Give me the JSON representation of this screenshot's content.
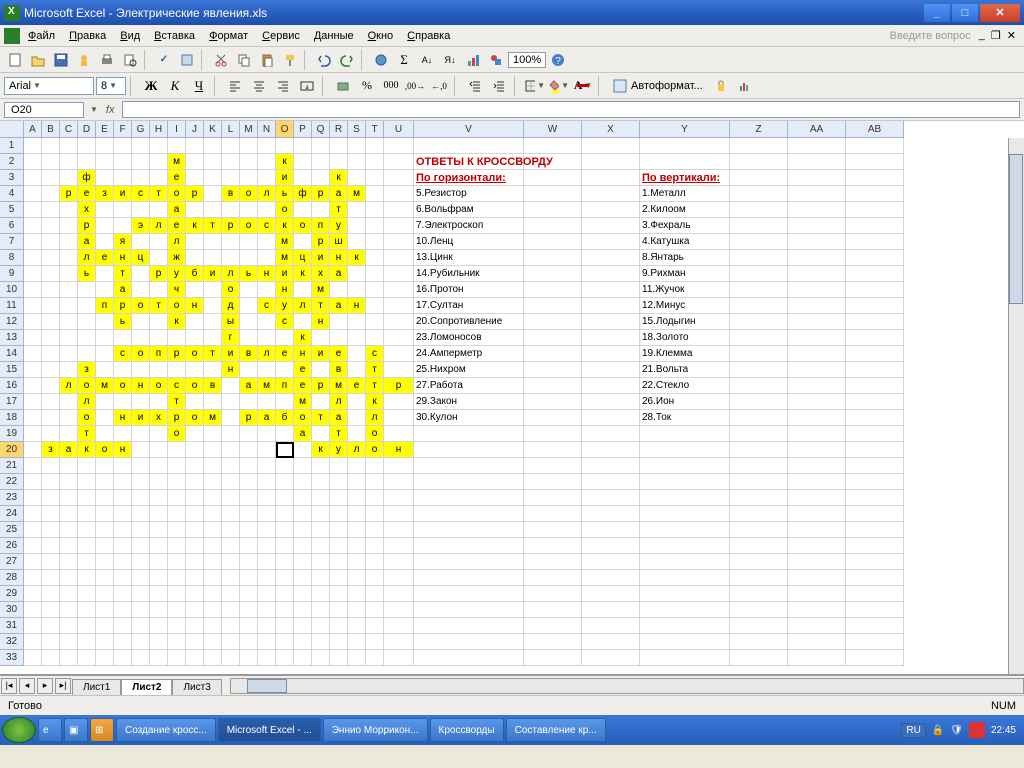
{
  "window": {
    "title": "Microsoft Excel - Электрические явления.xls"
  },
  "menu": [
    "Файл",
    "Правка",
    "Вид",
    "Вставка",
    "Формат",
    "Сервис",
    "Данные",
    "Окно",
    "Справка"
  ],
  "askbox": "Введите вопрос",
  "zoom": "100%",
  "font": {
    "name": "Arial",
    "size": "8"
  },
  "autoformat": "Автоформат...",
  "namebox": "O20",
  "columns": [
    "A",
    "B",
    "C",
    "D",
    "E",
    "F",
    "G",
    "H",
    "I",
    "J",
    "K",
    "L",
    "M",
    "N",
    "O",
    "P",
    "Q",
    "R",
    "S",
    "T",
    "U",
    "V",
    "W",
    "X",
    "Y",
    "Z",
    "AA",
    "AB"
  ],
  "narrow_count": 20,
  "row_count": 33,
  "selected": {
    "col": "O",
    "row": 20
  },
  "crossword": {
    "2": {
      "I": "м",
      "O": "к"
    },
    "3": {
      "D": "ф",
      "I": "е",
      "O": "и",
      "R": "к"
    },
    "4": {
      "C": "р",
      "D": "е",
      "E": "з",
      "F": "и",
      "G": "с",
      "H": "т",
      "I": "о",
      "J": "р",
      "L": "в",
      "M": "о",
      "N": "л",
      "O": "ь",
      "P": "ф",
      "Q": "р",
      "R": "а",
      "S": "м"
    },
    "5": {
      "D": "х",
      "I": "а",
      "O": "о",
      "R": "т"
    },
    "6": {
      "D": "р",
      "G": "э",
      "H": "л",
      "I": "е",
      "J": "к",
      "K": "т",
      "L": "р",
      "M": "о",
      "N": "с",
      "O": "к",
      "P": "о",
      "Q": "п",
      "R": "у"
    },
    "7": {
      "D": "а",
      "F": "я",
      "I": "л",
      "O": "м",
      "Q": "р",
      "R": "ш"
    },
    "8": {
      "D": "л",
      "E": "е",
      "F": "н",
      "G": "ц",
      "I": "ж",
      "O": "м",
      "P": "ц",
      "Q": "и",
      "R": "н",
      "S": "к"
    },
    "9": {
      "D": "ь",
      "F": "т",
      "H": "р",
      "I": "у",
      "J": "б",
      "K": "и",
      "L": "л",
      "M": "ь",
      "N": "н",
      "O": "и",
      "P": "к",
      "Q": "х",
      "R": "а"
    },
    "10": {
      "F": "а",
      "I": "ч",
      "L": "о",
      "O": "н",
      "Q": "м"
    },
    "11": {
      "E": "п",
      "F": "р",
      "G": "о",
      "H": "т",
      "I": "о",
      "J": "н",
      "L": "д",
      "N": "с",
      "O": "у",
      "P": "л",
      "Q": "т",
      "R": "а",
      "S": "н"
    },
    "12": {
      "F": "ь",
      "I": "к",
      "L": "ы",
      "O": "с",
      "Q": "н"
    },
    "13": {
      "L": "г",
      "P": "к"
    },
    "14": {
      "F": "с",
      "G": "о",
      "H": "п",
      "I": "р",
      "J": "о",
      "K": "т",
      "L": "и",
      "M": "в",
      "N": "л",
      "O": "е",
      "P": "н",
      "Q": "и",
      "R": "е",
      "T": "с"
    },
    "15": {
      "D": "з",
      "L": "н",
      "P": "е",
      "R": "в",
      "T": "т"
    },
    "16": {
      "C": "л",
      "D": "о",
      "E": "м",
      "F": "о",
      "G": "н",
      "H": "о",
      "I": "с",
      "J": "о",
      "K": "в",
      "M": "а",
      "N": "м",
      "O": "п",
      "P": "е",
      "Q": "р",
      "R": "м",
      "S": "е",
      "T": "т",
      "U": "р"
    },
    "17": {
      "D": "л",
      "I": "т",
      "P": "м",
      "R": "л",
      "T": "к"
    },
    "18": {
      "D": "о",
      "F": "н",
      "G": "и",
      "H": "х",
      "I": "р",
      "J": "о",
      "K": "м",
      "M": "р",
      "N": "а",
      "O": "б",
      "P": "о",
      "Q": "т",
      "R": "а",
      "T": "л"
    },
    "19": {
      "D": "т",
      "I": "о",
      "P": "а",
      "R": "т",
      "T": "о"
    },
    "20": {
      "B": "з",
      "C": "а",
      "D": "к",
      "E": "о",
      "F": "н",
      "Q": "к",
      "R": "у",
      "S": "л",
      "T": "о",
      "U": "н"
    }
  },
  "answers": {
    "title": "ОТВЕТЫ К КРОССВОРДУ",
    "horiz_label": "По горизонтали:",
    "vert_label": "По вертикали:",
    "horiz": [
      "5.Резистор",
      "6.Вольфрам",
      "7.Электроскоп",
      "10.Ленц",
      "13.Цинк",
      "14.Рубильник",
      "16.Протон",
      "17.Султан",
      "20.Сопротивление",
      "23.Ломоносов",
      "24.Амперметр",
      "25.Нихром",
      "27.Работа",
      "29.Закон",
      "30.Кулон"
    ],
    "vert": [
      "1.Металл",
      "2.Килоом",
      "3.Фехраль",
      "4.Катушка",
      "8.Янтарь",
      "9.Рихман",
      "11.Жучок",
      "12.Минус",
      "15.Лодыгин",
      "18.Золото",
      "19.Клемма",
      "21.Вольта",
      "22.Стекло",
      "26.Ион",
      "28.Ток"
    ]
  },
  "sheets": [
    "Лист1",
    "Лист2",
    "Лист3"
  ],
  "active_sheet": 1,
  "status": "Готово",
  "num_indicator": "NUM",
  "taskbar": {
    "items": [
      "Создание кросс...",
      "Microsoft Excel - ...",
      "Эннио Моррикон...",
      "Кроссворды",
      "Составление кр..."
    ],
    "active": 1,
    "lang": "RU",
    "time": "22:45"
  }
}
